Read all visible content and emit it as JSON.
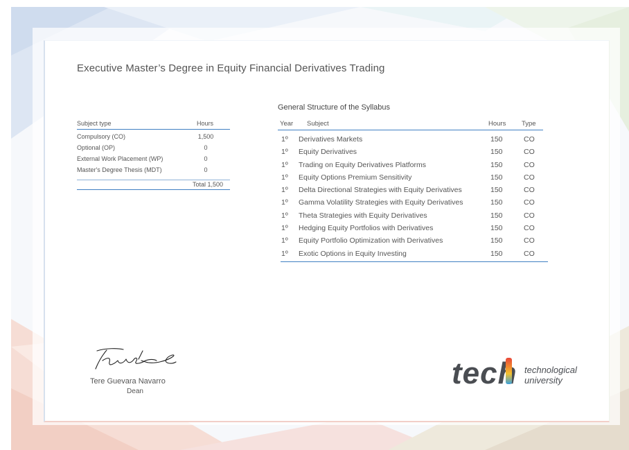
{
  "certificate": {
    "title": "Executive Master’s Degree in Equity Financial Derivatives Trading"
  },
  "summary": {
    "header_subject_type": "Subject type",
    "header_hours": "Hours",
    "rows": [
      {
        "type": "Compulsory (CO)",
        "hours": "1,500"
      },
      {
        "type": "Optional (OP)",
        "hours": "0"
      },
      {
        "type": "External Work Placement (WP)",
        "hours": "0"
      },
      {
        "type": "Master's Degree Thesis (MDT)",
        "hours": "0"
      }
    ],
    "total": "Total 1,500"
  },
  "syllabus": {
    "title": "General Structure of the Syllabus",
    "header_year": "Year",
    "header_subject": "Subject",
    "header_hours": "Hours",
    "header_type": "Type",
    "rows": [
      {
        "year": "1º",
        "subject": "Derivatives Markets",
        "hours": "150",
        "type": "CO"
      },
      {
        "year": "1º",
        "subject": "Equity Derivatives",
        "hours": "150",
        "type": "CO"
      },
      {
        "year": "1º",
        "subject": "Trading on Equity Derivatives Platforms",
        "hours": "150",
        "type": "CO"
      },
      {
        "year": "1º",
        "subject": "Equity Options Premium Sensitivity",
        "hours": "150",
        "type": "CO"
      },
      {
        "year": "1º",
        "subject": "Delta Directional Strategies with Equity Derivatives",
        "hours": "150",
        "type": "CO"
      },
      {
        "year": "1º",
        "subject": "Gamma Volatility Strategies with Equity Derivatives",
        "hours": "150",
        "type": "CO"
      },
      {
        "year": "1º",
        "subject": "Theta Strategies with Equity Derivatives",
        "hours": "150",
        "type": "CO"
      },
      {
        "year": "1º",
        "subject": "Hedging Equity Portfolios with Derivatives",
        "hours": "150",
        "type": "CO"
      },
      {
        "year": "1º",
        "subject": "Equity Portfolio Optimization with Derivatives",
        "hours": "150",
        "type": "CO"
      },
      {
        "year": "1º",
        "subject": "Exotic Options in Equity Investing",
        "hours": "150",
        "type": "CO"
      }
    ]
  },
  "signature": {
    "name": "Tere Guevara Navarro",
    "role": "Dean"
  },
  "logo": {
    "wordmark": "tech",
    "line1": "technological",
    "line2": "university"
  },
  "colors": {
    "accent_blue": "#3f7fc2",
    "logo_gray": "#4a4d52"
  }
}
